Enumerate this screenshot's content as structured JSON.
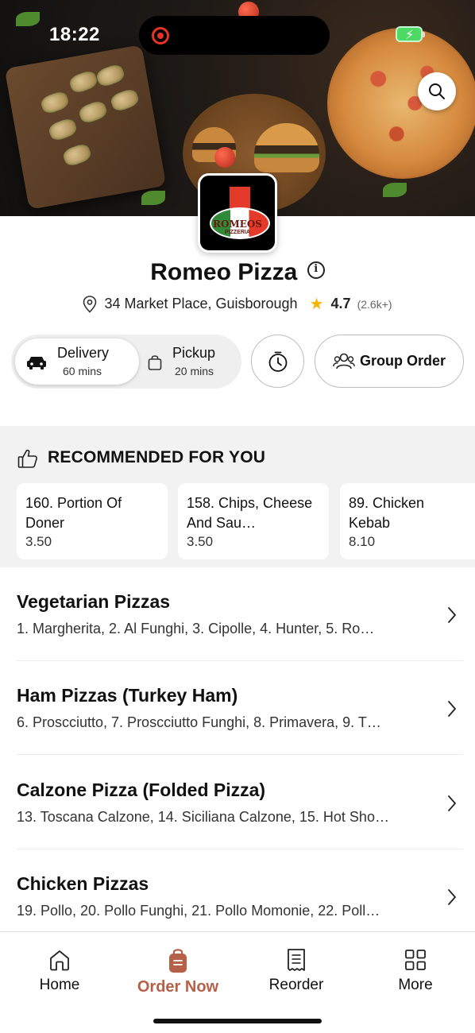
{
  "status_bar": {
    "time": "18:22"
  },
  "restaurant": {
    "name": "Romeo Pizza",
    "address": "34 Market Place, Guisborough",
    "rating": "4.7",
    "rating_count": "(2.6k+)",
    "logo_name": "ROMEOS",
    "logo_sub": "PIZZERIA"
  },
  "mode_toggle": {
    "delivery": {
      "label": "Delivery",
      "time": "60 mins",
      "selected": true
    },
    "pickup": {
      "label": "Pickup",
      "time": "20 mins",
      "selected": false
    }
  },
  "group_order_label": "Group Order",
  "recommended": {
    "heading": "RECOMMENDED FOR YOU",
    "items": [
      {
        "name": "160. Portion Of Doner",
        "price": "3.50"
      },
      {
        "name": "158. Chips, Cheese And Sau…",
        "price": "3.50"
      },
      {
        "name": "89. Chicken Kebab",
        "price": "8.10"
      }
    ]
  },
  "menu_categories": [
    {
      "title": "Vegetarian Pizzas",
      "items": "1. Margherita, 2. Al Funghi, 3. Cipolle, 4. Hunter, 5. Ro…"
    },
    {
      "title": "Ham Pizzas (Turkey Ham)",
      "items": "6. Proscciutto, 7. Proscciutto Funghi, 8. Primavera, 9. T…"
    },
    {
      "title": "Calzone Pizza (Folded Pizza)",
      "items": "13. Toscana Calzone, 14. Siciliana Calzone, 15. Hot Sho…"
    },
    {
      "title": "Chicken Pizzas",
      "items": "19. Pollo, 20. Pollo Funghi, 21. Pollo Momonie, 22. Poll…"
    }
  ],
  "tab_bar": {
    "items": [
      {
        "label": "Home",
        "icon": "home-icon",
        "active": false
      },
      {
        "label": "Order Now",
        "icon": "order-bag-icon",
        "active": true
      },
      {
        "label": "Reorder",
        "icon": "receipt-icon",
        "active": false
      },
      {
        "label": "More",
        "icon": "grid-icon",
        "active": false
      }
    ]
  },
  "colors": {
    "accent": "#b5614a",
    "rating_star": "#f5b400",
    "battery": "#4cd964",
    "record": "#e5332a"
  }
}
